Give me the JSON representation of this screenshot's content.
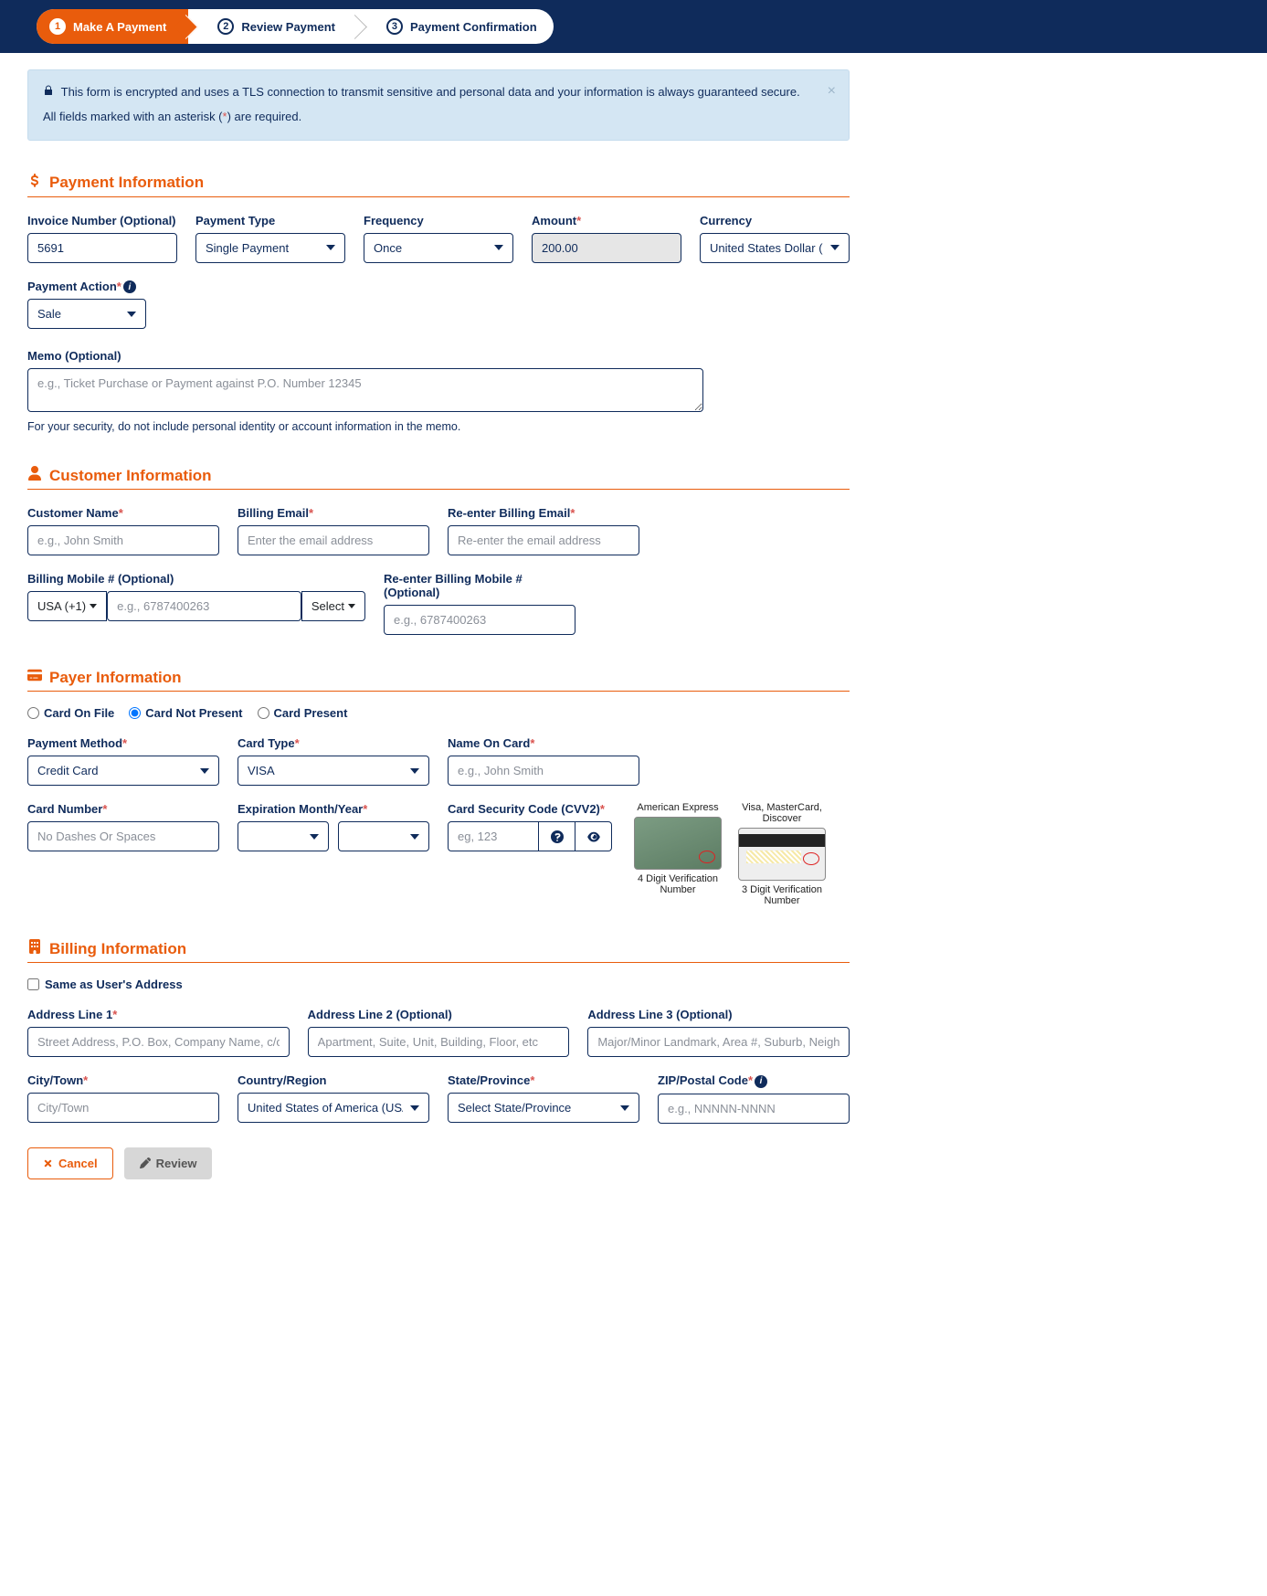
{
  "steps": {
    "s1": "Make A Payment",
    "s2": "Review Payment",
    "s3": "Payment Confirmation"
  },
  "alert": {
    "line1": "This form is encrypted and uses a TLS connection to transmit sensitive and personal data and your information is always guaranteed secure.",
    "line2_pre": "All fields marked with an asterisk (",
    "line2_mark": "*",
    "line2_post": ") are required."
  },
  "sections": {
    "payment": "Payment Information",
    "customer": "Customer Information",
    "payer": "Payer Information",
    "billing": "Billing Information"
  },
  "payment": {
    "invoice_label": "Invoice Number (Optional)",
    "invoice_value": "5691",
    "type_label": "Payment Type",
    "type_value": "Single Payment",
    "freq_label": "Frequency",
    "freq_value": "Once",
    "amount_label": "Amount",
    "amount_value": "200.00",
    "currency_label": "Currency",
    "currency_value": "United States Dollar (USD)",
    "action_label": "Payment Action",
    "action_value": "Sale",
    "memo_label": "Memo (Optional)",
    "memo_placeholder": "e.g., Ticket Purchase or Payment against P.O. Number 12345",
    "memo_hint": "For your security, do not include personal identity or account information in the memo."
  },
  "customer": {
    "name_label": "Customer Name",
    "name_placeholder": "e.g., John Smith",
    "email_label": "Billing Email",
    "email_placeholder": "Enter the email address",
    "reemail_label": "Re-enter Billing Email",
    "reemail_placeholder": "Re-enter the email address",
    "mobile_label": "Billing Mobile # (Optional)",
    "mobile_country": "USA (+1)",
    "mobile_placeholder": "e.g., 6787400263",
    "mobile_select": "Select",
    "remobile_label": "Re-enter Billing Mobile # (Optional)",
    "remobile_placeholder": "e.g., 6787400263"
  },
  "payer": {
    "radio_onfile": "Card On File",
    "radio_notpresent": "Card Not Present",
    "radio_present": "Card Present",
    "method_label": "Payment Method",
    "method_value": "Credit Card",
    "cardtype_label": "Card Type",
    "cardtype_value": "VISA",
    "nameoncard_label": "Name On Card",
    "nameoncard_placeholder": "e.g., John Smith",
    "cardnum_label": "Card Number",
    "cardnum_placeholder": "No Dashes Or Spaces",
    "exp_label": "Expiration Month/Year",
    "cvv_label": "Card Security Code (CVV2)",
    "cvv_placeholder": "eg, 123",
    "help_amex_title": "American Express",
    "help_amex_caption": "4 Digit Verification Number",
    "help_visa_title": "Visa, MasterCard, Discover",
    "help_visa_caption": "3 Digit Verification Number"
  },
  "billing": {
    "same_label": "Same as User's Address",
    "addr1_label": "Address Line 1",
    "addr1_placeholder": "Street Address, P.O. Box, Company Name, c/o",
    "addr2_label": "Address Line 2 (Optional)",
    "addr2_placeholder": "Apartment, Suite, Unit, Building, Floor, etc",
    "addr3_label": "Address Line 3 (Optional)",
    "addr3_placeholder": "Major/Minor Landmark, Area #, Suburb, Neighbor",
    "city_label": "City/Town",
    "city_placeholder": "City/Town",
    "country_label": "Country/Region",
    "country_value": "United States of America (USA)",
    "state_label": "State/Province",
    "state_value": "Select State/Province",
    "zip_label": "ZIP/Postal Code",
    "zip_placeholder": "e.g., NNNNN-NNNN"
  },
  "actions": {
    "cancel": "Cancel",
    "review": "Review"
  }
}
